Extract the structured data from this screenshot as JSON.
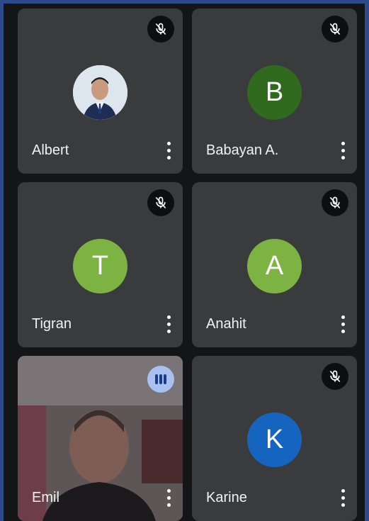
{
  "participants": [
    {
      "name": "Albert",
      "avatar_type": "photo",
      "muted": true
    },
    {
      "name": "Babayan A.",
      "avatar_type": "letter",
      "letter": "B",
      "color": "#2f6a1f",
      "muted": true
    },
    {
      "name": "Tigran",
      "avatar_type": "letter",
      "letter": "T",
      "color": "#7cb342",
      "muted": true
    },
    {
      "name": "Anahit",
      "avatar_type": "letter",
      "letter": "A",
      "color": "#7cb342",
      "muted": true
    },
    {
      "name": "Emil",
      "avatar_type": "video",
      "speaking": true
    },
    {
      "name": "Karine",
      "avatar_type": "letter",
      "letter": "K",
      "color": "#1565c0",
      "muted": true
    }
  ],
  "icons": {
    "muted": "mic-off-icon",
    "speaking": "audio-level-icon",
    "more": "more-vertical-icon"
  },
  "colors": {
    "tile_background": "#3a3b3d",
    "page_background": "#141516",
    "speaking_indicator": "#a8c1f0"
  }
}
